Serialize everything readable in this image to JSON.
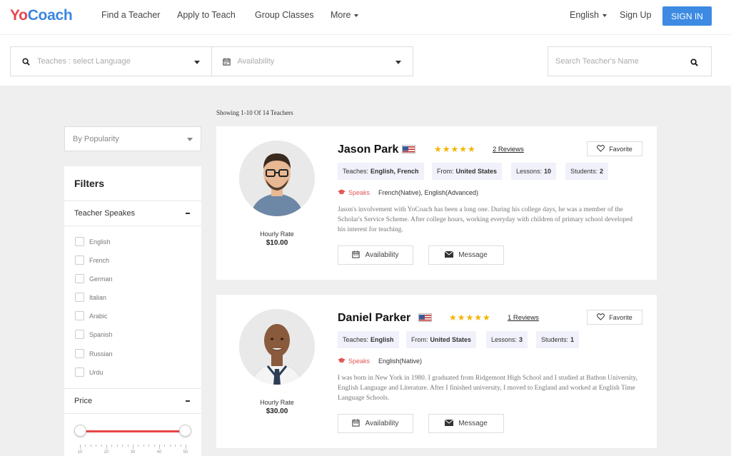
{
  "nav": {
    "logo_first": "Yo",
    "logo_rest": "Coach",
    "links": [
      "Find a Teacher",
      "Apply to Teach",
      "Group Classes"
    ],
    "more": "More",
    "language": "English",
    "signup": "Sign Up",
    "signin": "SIGN IN"
  },
  "search": {
    "language_placeholder": "Teaches : select Language",
    "availability_placeholder": "Availability",
    "name_placeholder": "Search Teacher's Name"
  },
  "results_text": "Showing 1-10 Of 14 Teachers",
  "sort": {
    "selected": "By Popularity"
  },
  "filters": {
    "title": "Filters",
    "teacher_speaks": {
      "label": "Teacher Speakes",
      "languages": [
        "English",
        "French",
        "German",
        "Italian",
        "Arabic",
        "Spanish",
        "Russian",
        "Urdu"
      ]
    },
    "price": {
      "label": "Price",
      "min_selected": 10,
      "max_selected": 50,
      "tick_labels": [
        "10",
        "20",
        "30",
        "40",
        "50"
      ]
    }
  },
  "teachers": [
    {
      "name": "Jason Park",
      "rating": 5,
      "reviews": "2 Reviews",
      "favorite": "Favorite",
      "teaches_label": "Teaches:",
      "teaches": "English, French",
      "from_label": "From:",
      "from": "United States",
      "lessons_label": "Lessons:",
      "lessons": "10",
      "students_label": "Students:",
      "students": "2",
      "speaks_label": "Speaks",
      "speaks": "French(Native), English(Advanced)",
      "bio": "Jason's involvement with YoCoach has been a long one. During his college days, he was a member of the Scholar's Service Scheme. After college hours, working everyday with children of primary school developed his interest for teaching.",
      "hourly_rate_label": "Hourly Rate",
      "hourly_rate": "$10.00",
      "availability_btn": "Availability",
      "message_btn": "Message",
      "skin": "#e8b894",
      "hair": "#3a2a1e",
      "shirt": "#6d87a6"
    },
    {
      "name": "Daniel Parker",
      "rating": 5,
      "reviews": "1 Reviews",
      "favorite": "Favorite",
      "teaches_label": "Teaches:",
      "teaches": "English",
      "from_label": "From:",
      "from": "United States",
      "lessons_label": "Lessons:",
      "lessons": "3",
      "students_label": "Students:",
      "students": "1",
      "speaks_label": "Speaks",
      "speaks": "English(Native)",
      "bio": "I was born in New York in 1980. I graduated from Ridgemont High School and I studied at Bathon University, English Language and Literature. After I finished university, I moved to England and worked at English Time Language Schools.",
      "hourly_rate_label": "Hourly Rate",
      "hourly_rate": "$30.00",
      "availability_btn": "Availability",
      "message_btn": "Message",
      "skin": "#8a5a3c",
      "hair": "#8a5a3c",
      "shirt": "#f4f4f4"
    }
  ],
  "colors": {
    "brand_blue": "#3c8ae2",
    "brand_red": "#e8444d",
    "star": "#f5b301"
  }
}
